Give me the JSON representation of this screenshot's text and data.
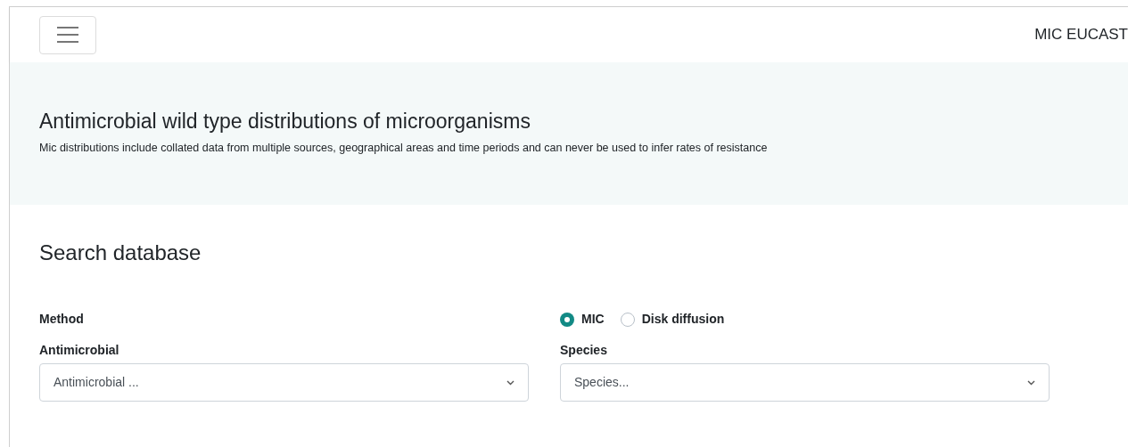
{
  "navbar": {
    "brand": "MIC EUCAST"
  },
  "banner": {
    "title": "Antimicrobial wild type distributions of microorganisms",
    "text": "Mic distributions include collated data from multiple sources, geographical areas and time periods and can never be used to infer rates of resistance"
  },
  "search": {
    "title": "Search database",
    "method_label": "Method",
    "methods": [
      {
        "label": "MIC",
        "selected": true
      },
      {
        "label": "Disk diffusion",
        "selected": false
      }
    ],
    "fields": [
      {
        "label": "Antimicrobial",
        "placeholder": "Antimicrobial ..."
      },
      {
        "label": "Species",
        "placeholder": "Species..."
      }
    ]
  }
}
